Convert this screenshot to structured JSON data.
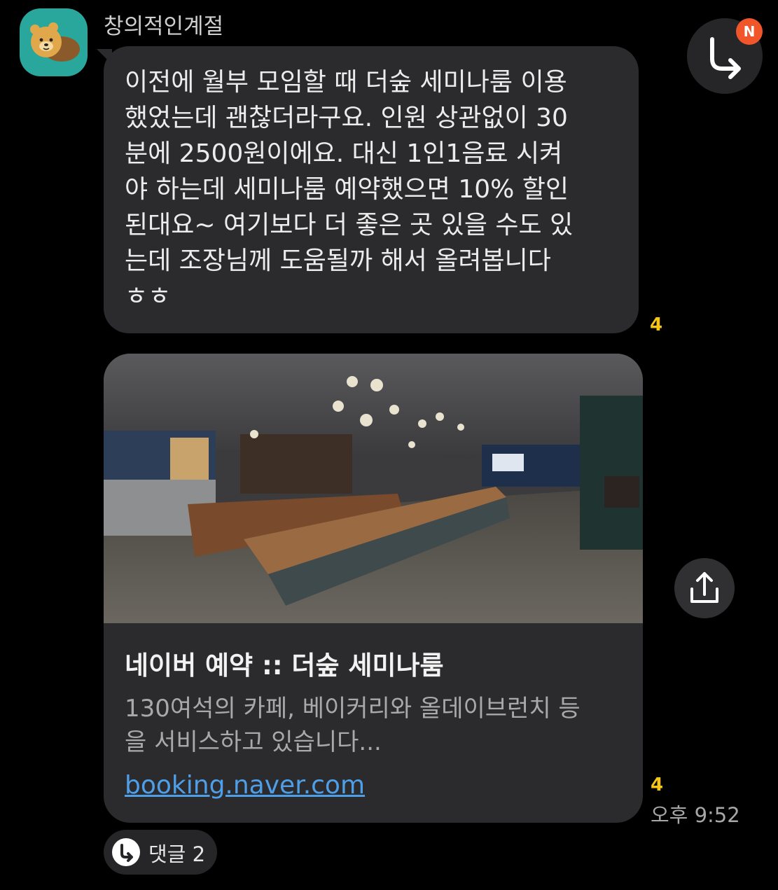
{
  "sender": {
    "name": "창의적인계절",
    "avatar_icon": "bear-character-avatar",
    "avatar_color": "#2aa79c"
  },
  "message": {
    "text": "이전에 월부 모임할 때 더숲 세미나룸 이용\n했었는데 괜찮더라구요. 인원 상관없이 30\n분에 2500원이에요. 대신 1인1음료 시켜\n야 하는데 세미나룸 예약했으면 10% 할인\n된대요~ 여기보다 더 좋은 곳 있을 수도 있\n는데 조장님께 도움될까 해서 올려봅니다\nㅎㅎ",
    "unread_count": "4"
  },
  "link_card": {
    "image_icon": "cafe-interior-photo",
    "title": "네이버 예약 :: 더숲 세미나룸",
    "description": "130여석의 카페, 베이커리와 올데이브런치 등\n을 서비스하고 있습니다...",
    "url": "booking.naver.com",
    "unread_count": "4",
    "time": "오후 9:52"
  },
  "actions": {
    "reply_icon": "reply-arrow-icon",
    "new_badge": "N",
    "share_icon": "share-icon"
  },
  "comments": {
    "label": "댓글 2",
    "icon": "reply-bubble-icon"
  },
  "colors": {
    "background": "#000000",
    "bubble": "#2b2b2d",
    "unread": "#f5c518",
    "link": "#4f9fe8",
    "badge": "#f0562a"
  }
}
